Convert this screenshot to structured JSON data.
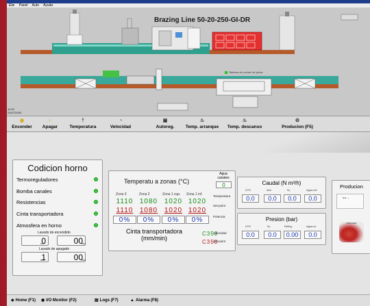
{
  "menu": [
    "Eile",
    "Panel",
    "Auto",
    "Ayuda"
  ],
  "sim": {
    "title": "Brazing Line 50-20-250-GI-DR",
    "legend": "Sistema de control de pieza",
    "corner_lines": [
      "16:32",
      "20/07/2005"
    ]
  },
  "toolbar": [
    {
      "name": "encender",
      "label": "Encender",
      "icon": "bulb-on-icon",
      "glyph": "◍"
    },
    {
      "name": "apagar",
      "label": "Apagar",
      "icon": "bulb-off-icon",
      "glyph": "○"
    },
    {
      "name": "temperatura",
      "label": "Temperatura",
      "icon": "thermometer-icon",
      "glyph": "†"
    },
    {
      "name": "velocidad",
      "label": "Velocidad",
      "icon": "speedometer-icon",
      "glyph": "◔"
    },
    {
      "name": "autoreg",
      "label": "Autoreg.",
      "icon": "controller-icon",
      "glyph": "▣"
    },
    {
      "name": "temp-arranque",
      "label": "Temp. arranque",
      "icon": "heater-start-icon",
      "glyph": "♨"
    },
    {
      "name": "temp-descanso",
      "label": "Temp. descanso",
      "icon": "heater-rest-icon",
      "glyph": "♨"
    },
    {
      "name": "produccion",
      "label": "Producion (F5)",
      "icon": "production-icon",
      "glyph": "⚙"
    }
  ],
  "condicion": {
    "title": "Codicion horno",
    "items": [
      "Termoreguladores",
      "Bomba canales",
      "Resistencias",
      "Cinta transportadora",
      "Atmosfera en horno"
    ],
    "status_color": "#35d235",
    "lavado_encendido": {
      "label": "Lavado de encendido",
      "min": "0",
      "sec": "00",
      "min_unit": "min",
      "sec_unit": "sec"
    },
    "lavado_apagado": {
      "label": "Lavado de apagado",
      "min": "1",
      "sec": "00",
      "min_unit": "min",
      "sec_unit": "sec"
    }
  },
  "temperatura": {
    "title": "Temperatu a zonas (°C)",
    "zones": [
      "Zona 3",
      "Zona 2",
      "Zona 1 sup.",
      "Zona 1 inf."
    ],
    "temperatura": [
      "1110",
      "1080",
      "1020",
      "1020"
    ],
    "set_point": [
      "1110",
      "1080",
      "1020",
      "1020"
    ],
    "potencia": [
      "0%",
      "0%",
      "0%",
      "0%"
    ],
    "row_labels": [
      "Temperatura",
      "Set-point",
      "Potencia"
    ],
    "agua_label": "Agua canales",
    "agua_value": "0",
    "cinta_label": "Cinta transportadora (mm/min)",
    "velocidad": "C350",
    "velocidad_sp": "C350",
    "vel_labels": [
      "Velocidad",
      "Set-point"
    ]
  },
  "caudal": {
    "title": "Caudal (N m³/h)",
    "headers": [
      "LPG",
      "Aire",
      "N₂",
      "Agua ref."
    ],
    "values": [
      "0.0",
      "0.0",
      "0.0",
      "0.0"
    ]
  },
  "presion": {
    "title": "Presion (bar)",
    "headers": [
      "LPG",
      "N₂",
      "Refrig.",
      "Agua re."
    ],
    "values": [
      "0.0",
      "0.0",
      "0.00",
      "0.0"
    ]
  },
  "produccion": {
    "title": "Producion",
    "thumb_text": "N.E. —",
    "logo_text": "ESSCAME"
  },
  "statusbar": [
    {
      "name": "home",
      "label": "Home (F1)",
      "icon": "home-icon",
      "glyph": "◈"
    },
    {
      "name": "io-monitor",
      "label": "I/O Monitor (F2)",
      "icon": "monitor-icon",
      "glyph": "◉"
    },
    {
      "name": "logs",
      "label": "Logs (F7)",
      "icon": "logs-icon",
      "glyph": "▤"
    },
    {
      "name": "alarma",
      "label": "Alarma (F8)",
      "icon": "alarm-icon",
      "glyph": "▲"
    }
  ]
}
